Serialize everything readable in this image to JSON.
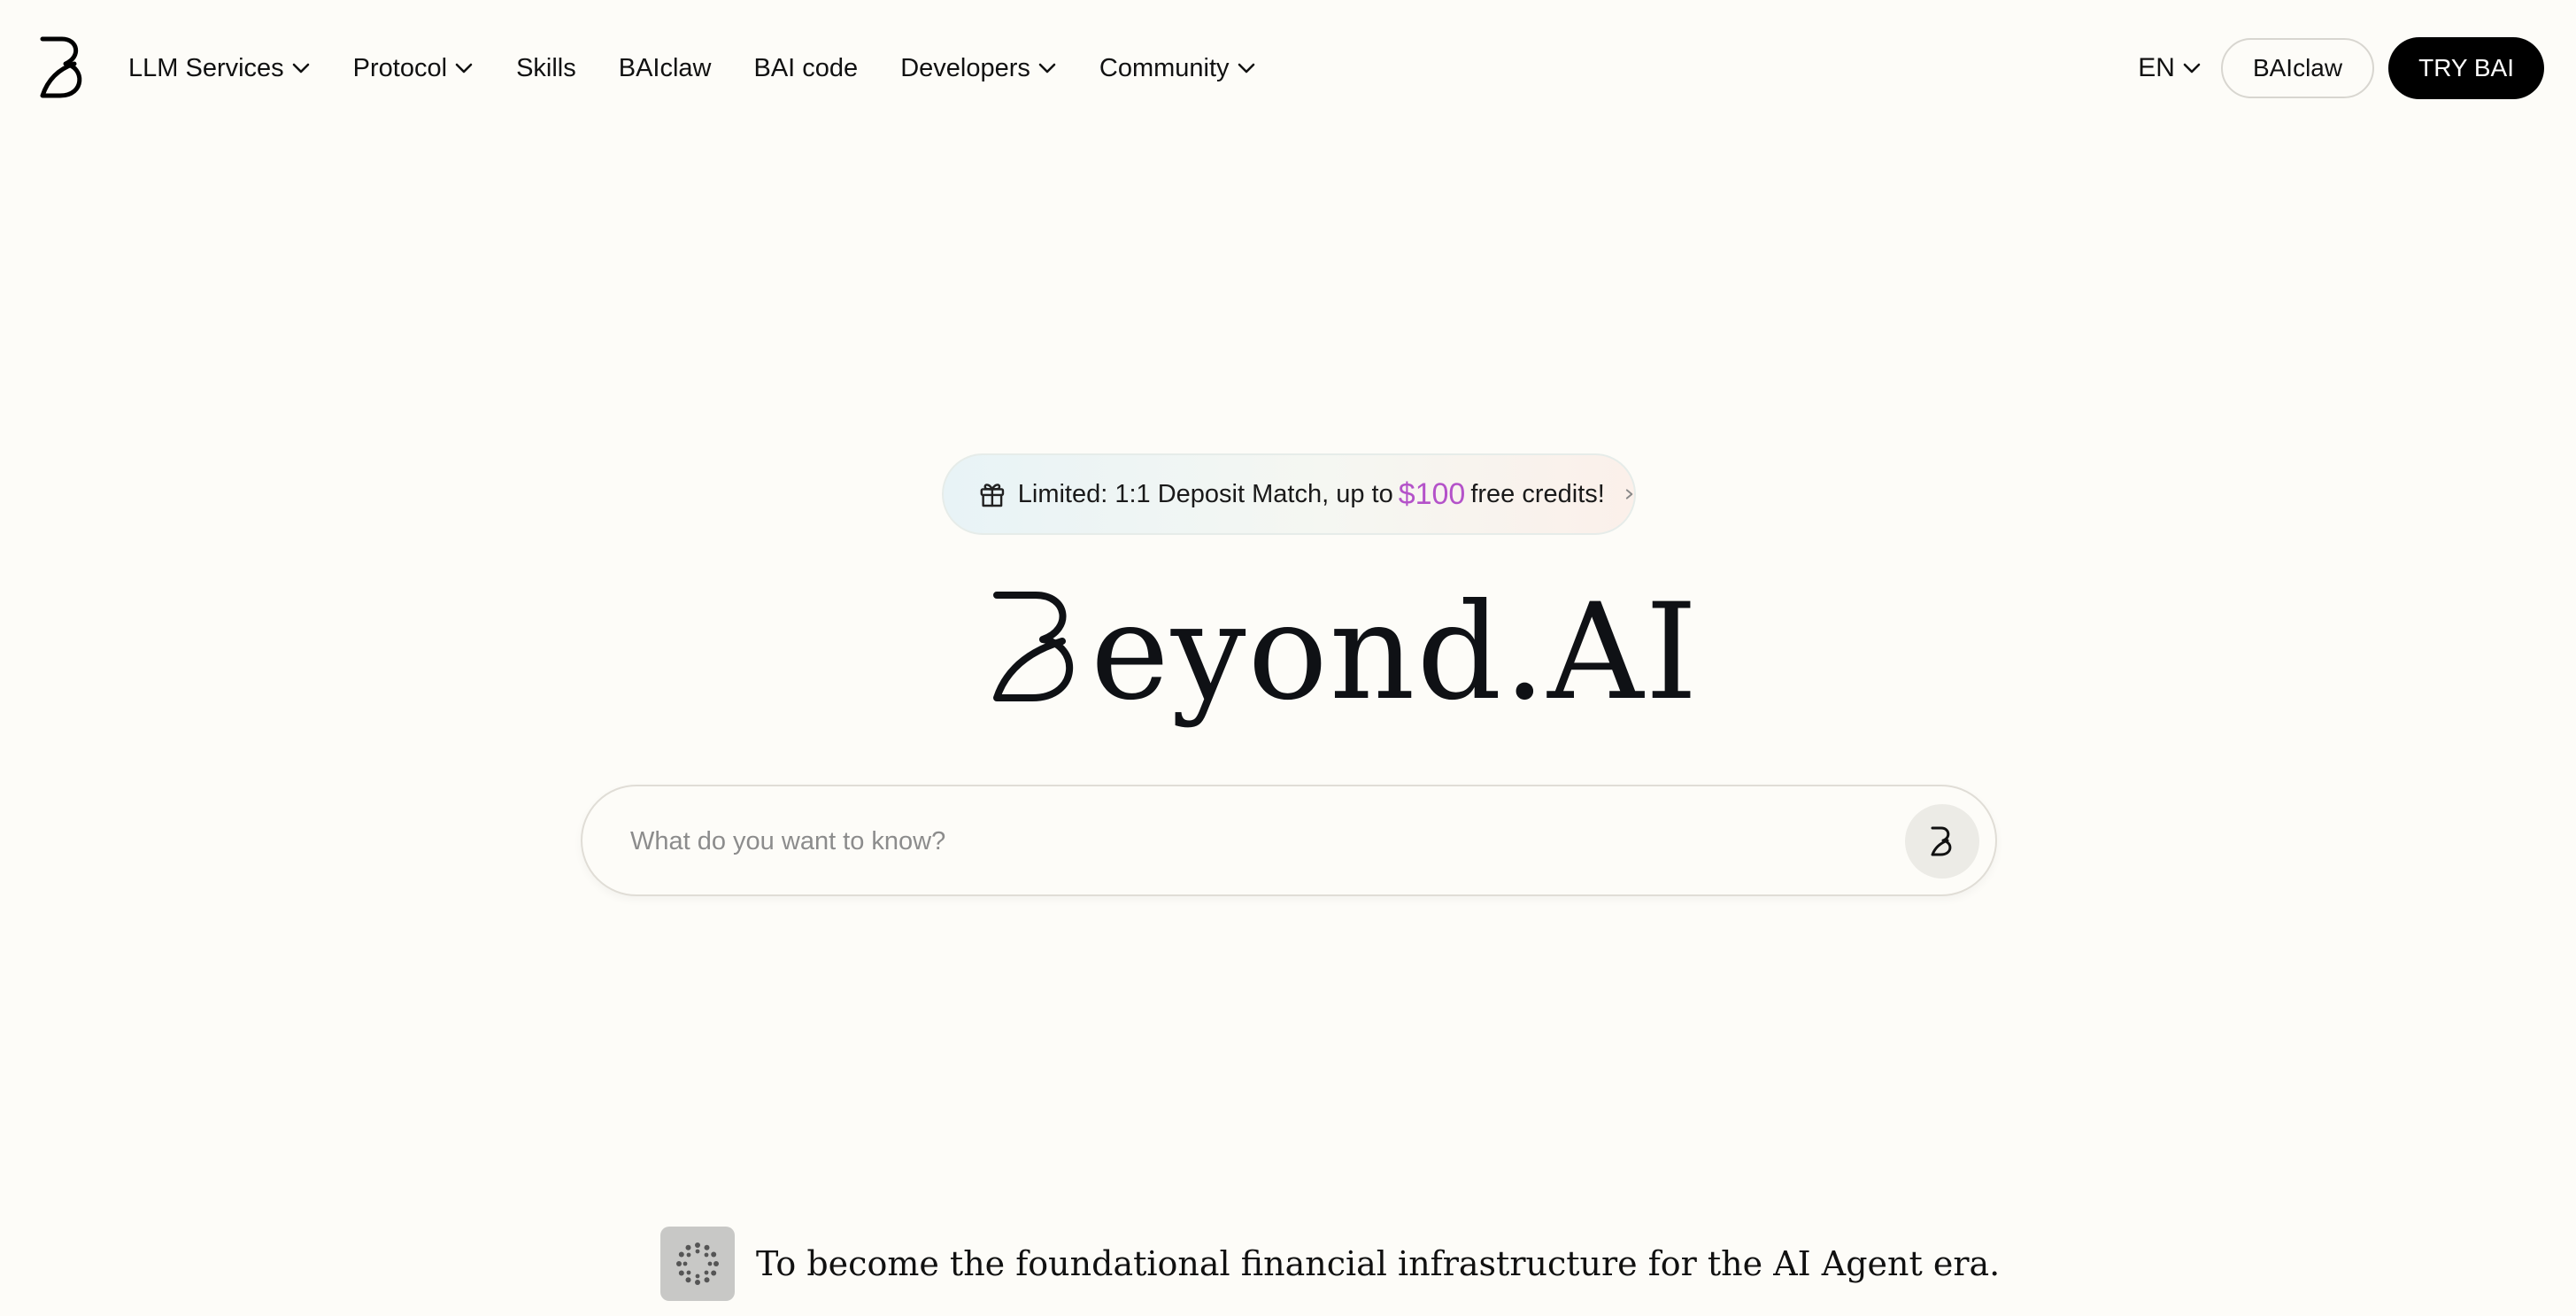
{
  "nav": {
    "logo_icon": "beyond-b-logo",
    "items": [
      {
        "label": "LLM Services",
        "dropdown": true
      },
      {
        "label": "Protocol",
        "dropdown": true
      },
      {
        "label": "Skills",
        "dropdown": false
      },
      {
        "label": "BAIclaw",
        "dropdown": false
      },
      {
        "label": "BAI code",
        "dropdown": false
      },
      {
        "label": "Developers",
        "dropdown": true
      },
      {
        "label": "Community",
        "dropdown": true
      }
    ],
    "language": "EN",
    "baiclaw_button": "BAIclaw",
    "try_button": "TRY BAI"
  },
  "promo": {
    "icon": "gift-icon",
    "prefix": "Limited: 1:1 Deposit Match, up to",
    "amount": "$100",
    "suffix": "free credits!",
    "amount_color": "#b452c9"
  },
  "hero": {
    "wordmark": "eyond.AI",
    "wordmark_full": "Beyond.AI"
  },
  "search": {
    "placeholder": "What do you want to know?",
    "value": "",
    "send_icon": "beyond-b-logo"
  },
  "mission": {
    "icon": "loading-spinner-icon",
    "text": "To become the foundational financial infrastructure for the AI Agent era."
  },
  "colors": {
    "background": "#fdfcf8",
    "text": "#0d0d0d",
    "primary_button": "#000000"
  }
}
